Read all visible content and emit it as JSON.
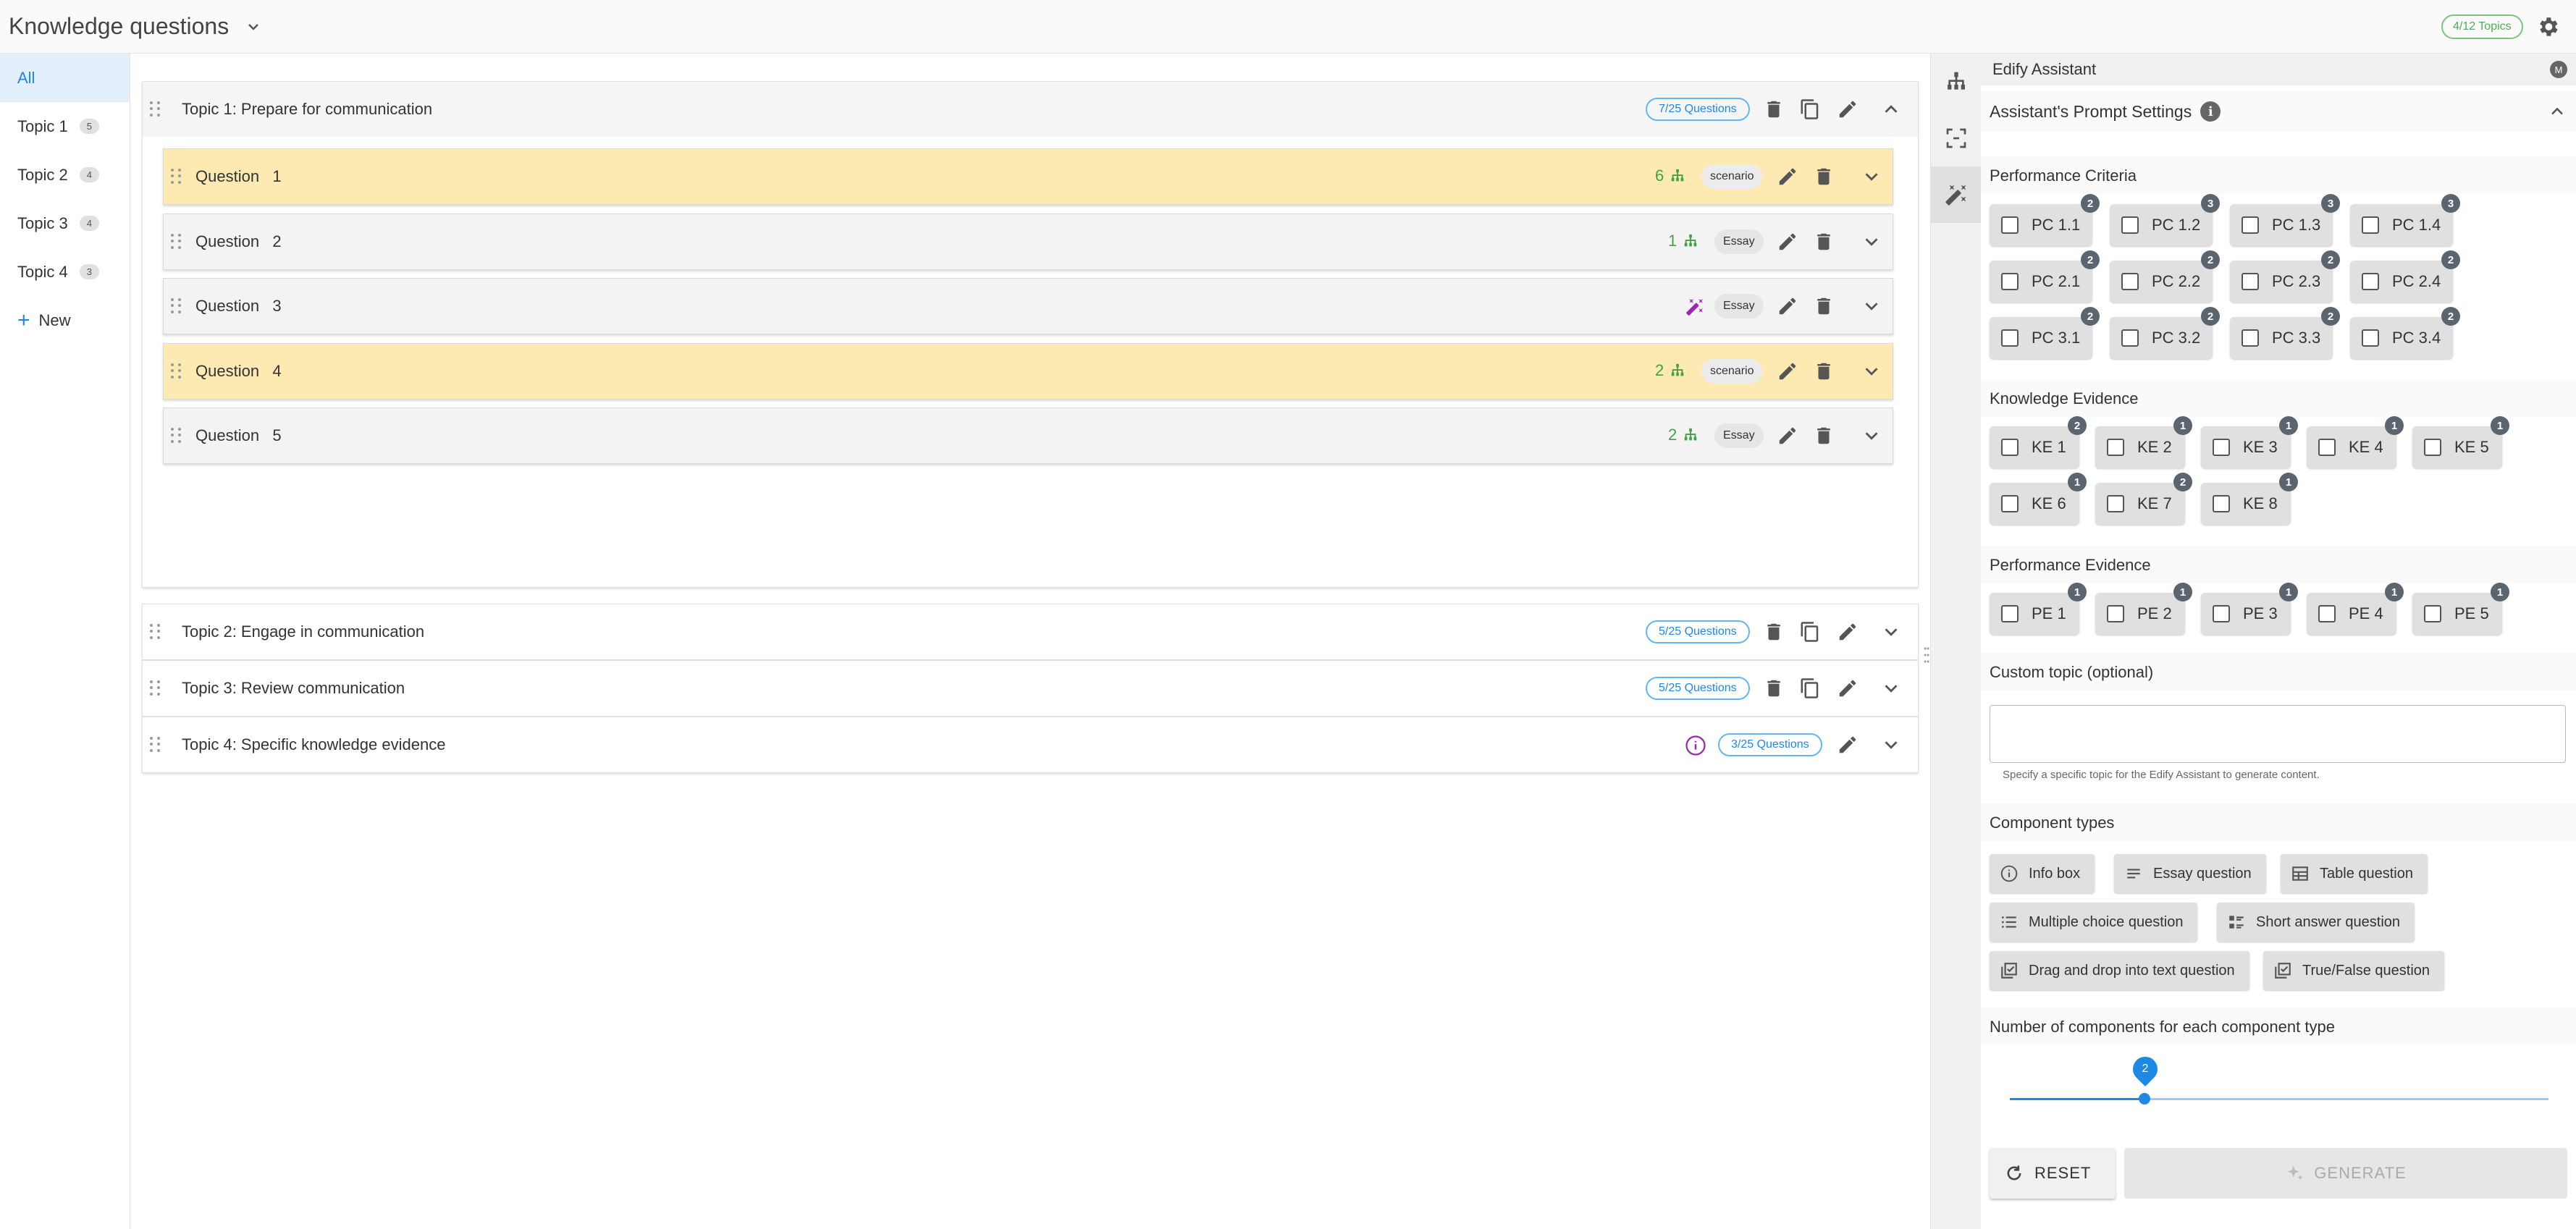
{
  "header": {
    "title": "Knowledge questions",
    "topics_badge": "4/12 Topics"
  },
  "sidebar": {
    "items": [
      {
        "label": "All",
        "count": null
      },
      {
        "label": "Topic 1",
        "count": "5"
      },
      {
        "label": "Topic 2",
        "count": "4"
      },
      {
        "label": "Topic 3",
        "count": "4"
      },
      {
        "label": "Topic 4",
        "count": "3"
      }
    ],
    "new_label": "New"
  },
  "topics": [
    {
      "title": "Topic 1: Prepare for communication",
      "badge": "7/25 Questions",
      "questions": [
        {
          "title": "Question   1",
          "count": "6",
          "type": "scenario"
        },
        {
          "title": "Question   2",
          "count": "1",
          "type": "Essay"
        },
        {
          "title": "Question   3",
          "count": "",
          "type": "Essay"
        },
        {
          "title": "Question   4",
          "count": "2",
          "type": "scenario"
        },
        {
          "title": "Question   5",
          "count": "2",
          "type": "Essay"
        }
      ]
    },
    {
      "title": "Topic 2: Engage in communication",
      "badge": "5/25 Questions"
    },
    {
      "title": "Topic 3: Review communication",
      "badge": "5/25 Questions"
    },
    {
      "title": "Topic 4: Specific knowledge evidence",
      "badge": "3/25 Questions"
    }
  ],
  "assistant": {
    "name": "Edify Assistant",
    "logo_letter": "M",
    "prompt_settings": "Assistant's Prompt Settings",
    "info_icon": "i",
    "performance_criteria": {
      "title": "Performance Criteria",
      "items": [
        {
          "label": "PC 1.1",
          "badge": "2"
        },
        {
          "label": "PC 1.2",
          "badge": "3"
        },
        {
          "label": "PC 1.3",
          "badge": "3"
        },
        {
          "label": "PC 1.4",
          "badge": "3"
        },
        {
          "label": "PC 2.1",
          "badge": "2"
        },
        {
          "label": "PC 2.2",
          "badge": "2"
        },
        {
          "label": "PC 2.3",
          "badge": "2"
        },
        {
          "label": "PC 2.4",
          "badge": "2"
        },
        {
          "label": "PC 3.1",
          "badge": "2"
        },
        {
          "label": "PC 3.2",
          "badge": "2"
        },
        {
          "label": "PC 3.3",
          "badge": "2"
        },
        {
          "label": "PC 3.4",
          "badge": "2"
        }
      ]
    },
    "knowledge_evidence": {
      "title": "Knowledge Evidence",
      "items": [
        {
          "label": "KE 1",
          "badge": "2"
        },
        {
          "label": "KE 2",
          "badge": "1"
        },
        {
          "label": "KE 3",
          "badge": "1"
        },
        {
          "label": "KE 4",
          "badge": "1"
        },
        {
          "label": "KE 5",
          "badge": "1"
        },
        {
          "label": "KE 6",
          "badge": "1"
        },
        {
          "label": "KE 7",
          "badge": "2"
        },
        {
          "label": "KE 8",
          "badge": "1"
        }
      ]
    },
    "performance_evidence": {
      "title": "Performance Evidence",
      "items": [
        {
          "label": "PE 1",
          "badge": "1"
        },
        {
          "label": "PE 2",
          "badge": "1"
        },
        {
          "label": "PE 3",
          "badge": "1"
        },
        {
          "label": "PE 4",
          "badge": "1"
        },
        {
          "label": "PE 5",
          "badge": "1"
        }
      ]
    },
    "custom_topic": {
      "title": "Custom topic (optional)",
      "value": "",
      "helper": "Specify a specific topic for the Edify Assistant to generate content."
    },
    "component_types": {
      "title": "Component types",
      "items": [
        "Info box",
        "Essay question",
        "Table question",
        "Multiple choice question",
        "Short answer question",
        "Drag and drop into text question",
        "True/False question"
      ]
    },
    "components_count": {
      "title": "Number of components for each component type",
      "value": "2"
    },
    "reset_label": "RESET",
    "generate_label": "GENERATE"
  },
  "colors": {
    "accent": "#1e88e5",
    "highlight": "#fde9b2",
    "success": "#43a047",
    "magic": "#9c27b0"
  }
}
